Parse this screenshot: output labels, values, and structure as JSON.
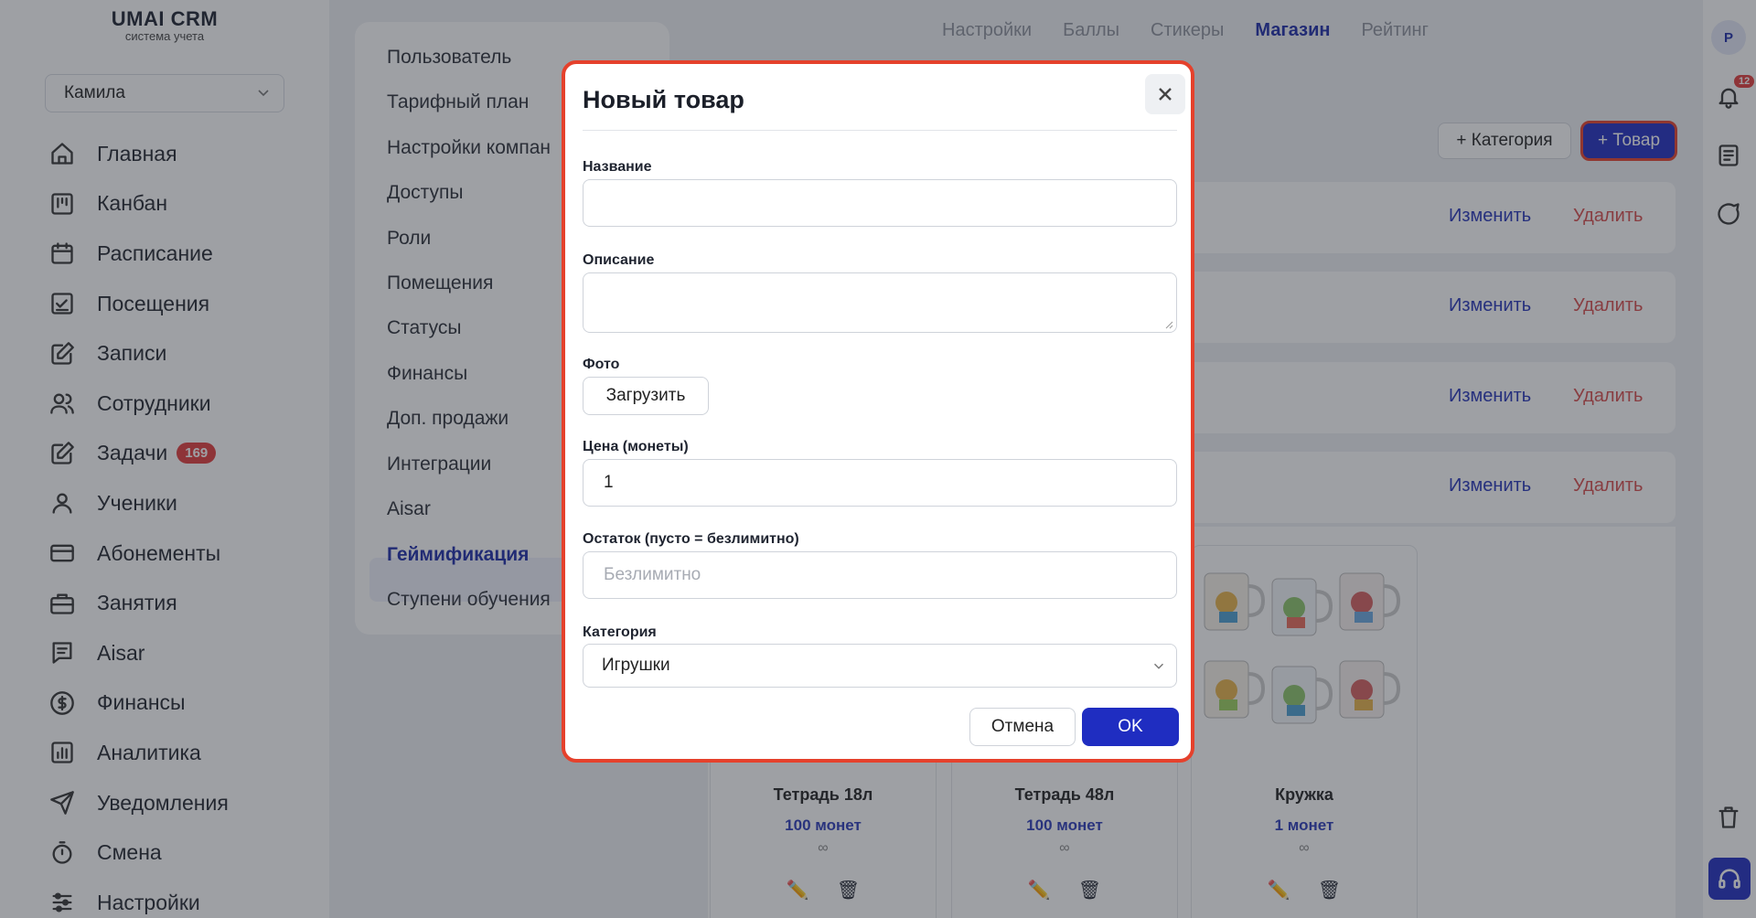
{
  "app": {
    "logo_title": "UMAI CRM",
    "logo_subtitle": "система учета"
  },
  "user_select": {
    "value": "Камила"
  },
  "nav": {
    "items": [
      {
        "label": "Главная",
        "icon": "home-icon"
      },
      {
        "label": "Канбан",
        "icon": "kanban-icon"
      },
      {
        "label": "Расписание",
        "icon": "calendar-icon"
      },
      {
        "label": "Посещения",
        "icon": "attendance-icon"
      },
      {
        "label": "Записи",
        "icon": "edit-icon"
      },
      {
        "label": "Сотрудники",
        "icon": "users-icon"
      },
      {
        "label": "Задачи",
        "icon": "tasks-icon",
        "badge": "169"
      },
      {
        "label": "Ученики",
        "icon": "user-icon"
      },
      {
        "label": "Абонементы",
        "icon": "card-icon"
      },
      {
        "label": "Занятия",
        "icon": "briefcase-icon"
      },
      {
        "label": "Aisar",
        "icon": "chat-icon"
      },
      {
        "label": "Финансы",
        "icon": "dollar-icon"
      },
      {
        "label": "Аналитика",
        "icon": "chart-icon"
      },
      {
        "label": "Уведомления",
        "icon": "send-icon"
      },
      {
        "label": "Смена",
        "icon": "timer-icon"
      },
      {
        "label": "Настройки",
        "icon": "sliders-icon"
      }
    ]
  },
  "submenu": {
    "items": [
      "Пользователь",
      "Тарифный план",
      "Настройки компан",
      "Доступы",
      "Роли",
      "Помещения",
      "Статусы",
      "Финансы",
      "Доп. продажи",
      "Интеграции",
      "Aisar",
      "Геймификация",
      "Ступени обучения"
    ],
    "active": "Геймификация"
  },
  "tabs": [
    "Настройки",
    "Баллы",
    "Стикеры",
    "Магазин",
    "Рейтинг"
  ],
  "active_tab": "Магазин",
  "main": {
    "add_category_label": "+ Категория",
    "add_product_label": "+ Товар",
    "edit_label": "Изменить",
    "delete_label": "Удалить",
    "products": [
      {
        "name": "Тетрадь 18л",
        "price": "100 монет",
        "stock": "∞"
      },
      {
        "name": "Тетрадь 48л",
        "price": "100 монет",
        "stock": "∞"
      },
      {
        "name": "Кружка",
        "price": "1 монет",
        "stock": "∞"
      }
    ]
  },
  "rail": {
    "avatar_initial": "Р",
    "notifications_count": "12"
  },
  "modal": {
    "title": "Новый товар",
    "name_label": "Название",
    "name_value": "",
    "description_label": "Описание",
    "description_value": "",
    "photo_label": "Фото",
    "upload_label": "Загрузить",
    "price_label": "Цена (монеты)",
    "price_value": "1",
    "stock_label": "Остаток (пусто = безлимитно)",
    "stock_placeholder": "Безлимитно",
    "category_label": "Категория",
    "category_value": "Игрушки",
    "cancel_label": "Отмена",
    "ok_label": "OK"
  },
  "colors": {
    "accent": "#1f2dc1",
    "highlight": "#e5412c",
    "danger": "#d84b4b"
  }
}
